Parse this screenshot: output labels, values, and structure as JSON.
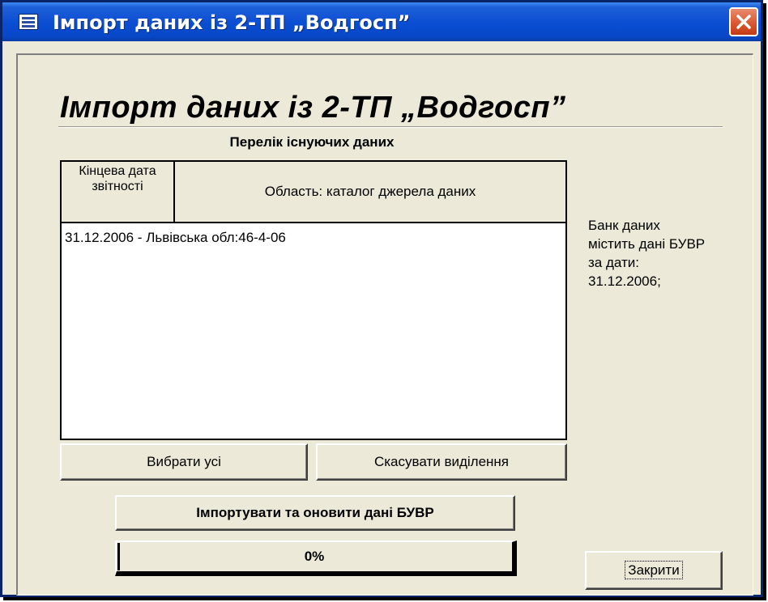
{
  "window": {
    "title": "Імпорт даних із 2-ТП „Водгосп”"
  },
  "form": {
    "heading": "Імпорт даних із 2-ТП „Водгосп”",
    "list_title": "Перелік існуючих даних",
    "columns": {
      "date": "Кінцева дата звітності",
      "area": "Область: каталог джерела даних"
    },
    "rows": [
      "31.12.2006 - Львівська обл:46-4-06"
    ],
    "buttons": {
      "select_all": "Вибрати усі",
      "deselect": "Скасувати виділення",
      "import": "Імпортувати та оновити дані БУВР",
      "close": "Закрити"
    },
    "progress": {
      "percent": 0,
      "label": "0%"
    },
    "status_lines": [
      "Банк даних",
      "містить дані БУВР",
      "за дати:",
      "31.12.2006;"
    ]
  }
}
